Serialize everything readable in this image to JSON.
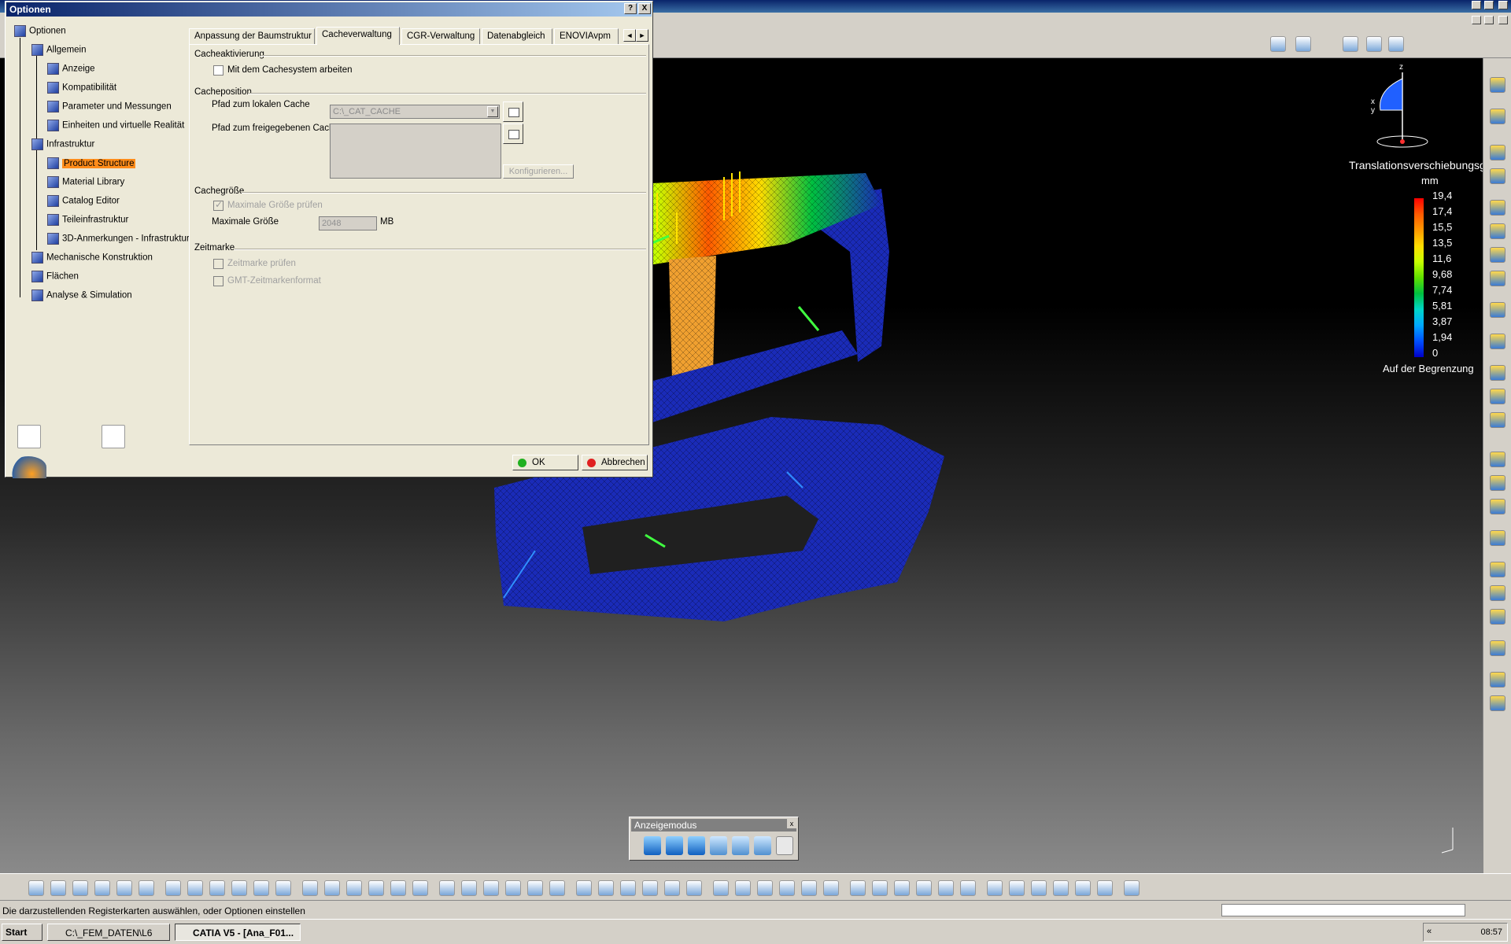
{
  "dialog": {
    "title": "Optionen",
    "help_label": "?",
    "close_label": "X",
    "tree": [
      {
        "label": "Optionen",
        "level": 0
      },
      {
        "label": "Allgemein",
        "level": 1
      },
      {
        "label": "Anzeige",
        "level": 2
      },
      {
        "label": "Kompatibilität",
        "level": 2
      },
      {
        "label": "Parameter und Messungen",
        "level": 2
      },
      {
        "label": "Einheiten und virtuelle Realität",
        "level": 2
      },
      {
        "label": "Infrastruktur",
        "level": 1
      },
      {
        "label": "Product Structure",
        "level": 2,
        "selected": true
      },
      {
        "label": "Material Library",
        "level": 2
      },
      {
        "label": "Catalog Editor",
        "level": 2
      },
      {
        "label": "Teileinfrastruktur",
        "level": 2
      },
      {
        "label": "3D-Anmerkungen - Infrastruktur",
        "level": 2
      },
      {
        "label": "Mechanische Konstruktion",
        "level": 1
      },
      {
        "label": "Flächen",
        "level": 1
      },
      {
        "label": "Analyse & Simulation",
        "level": 1
      }
    ],
    "tabs": [
      {
        "label": "Anpassung der Baumstruktur"
      },
      {
        "label": "Cacheverwaltung",
        "active": true
      },
      {
        "label": "CGR-Verwaltung"
      },
      {
        "label": "Datenabgleich"
      },
      {
        "label": "ENOVIAvpm"
      }
    ],
    "tab_scroll_left": "◄",
    "tab_scroll_right": "►",
    "cacheaktivierung": {
      "title": "Cacheaktivierung",
      "checkbox_label": "Mit dem Cachesystem arbeiten"
    },
    "cacheposition": {
      "title": "Cacheposition",
      "local_label": "Pfad zum lokalen Cache",
      "local_value": "C:\\_CAT_CACHE",
      "shared_label": "Pfad zum freigegebenen Cache",
      "configure_label": "Konfigurieren..."
    },
    "cachegroesse": {
      "title": "Cachegröße",
      "checkbox_label": "Maximale Größe prüfen",
      "max_label": "Maximale Größe",
      "max_value": "2048",
      "unit": "MB"
    },
    "zeitmarke": {
      "title": "Zeitmarke",
      "check_label": "Zeitmarke prüfen",
      "gmt_label": "GMT-Zeitmarkenformat"
    },
    "ok_label": "OK",
    "cancel_label": "Abbrechen"
  },
  "legend": {
    "title": "Translationsverschiebungsg",
    "unit": "mm",
    "values": [
      "19,4",
      "17,4",
      "15,5",
      "13,5",
      "11,6",
      "9,68",
      "7,74",
      "5,81",
      "3,87",
      "1,94",
      "0"
    ],
    "footer": "Auf der Begrenzung"
  },
  "compass": {
    "z": "z",
    "x": "x",
    "y": "y"
  },
  "anzeigemodus": {
    "title": "Anzeigemodus",
    "close": "x"
  },
  "status": {
    "text": "Die darzustellenden Registerkarten auswählen, oder Optionen einstellen"
  },
  "taskbar": {
    "start": "Start",
    "items": [
      {
        "label": "C:\\_FEM_DATEN\\L6"
      },
      {
        "label": "CATIA V5 - [Ana_F01...",
        "active": true
      }
    ],
    "tray_arrows": "«",
    "clock": "08:57"
  },
  "colors": {
    "mesh_blue": "#1a2bb8",
    "selection_orange": "#ff8c1a",
    "titlebar": "#0a246a"
  }
}
